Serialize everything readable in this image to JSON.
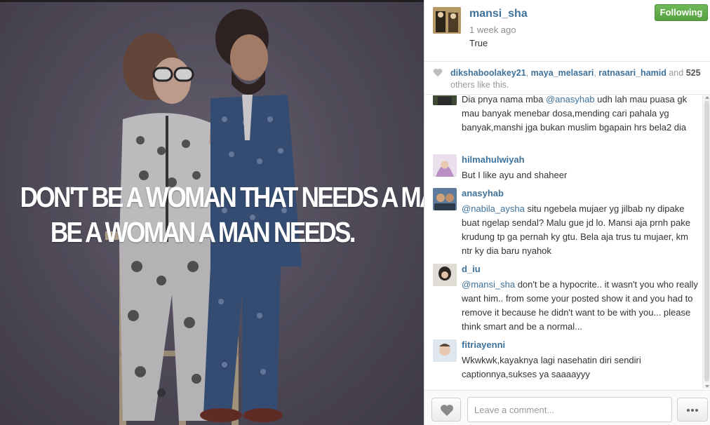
{
  "post": {
    "quote_line1": "DON'T BE A WOMAN THAT NEEDS A MAN,",
    "quote_line2": "BE A WOMAN A MAN NEEDS."
  },
  "header": {
    "username": "mansi_sha",
    "time_ago": "1 week ago",
    "caption": "True",
    "follow_label": "Following",
    "follow_color": "#5fae48"
  },
  "likes": {
    "user1": "dikshaboolakey21",
    "user2": "maya_melasari",
    "user3": "ratnasari_hamid",
    "and": "and",
    "count": "525",
    "suffix": "others like this.",
    "sep": ","
  },
  "comments": {
    "c0": {
      "text_a": "Dia pnya nama mba ",
      "mention": "@anasyhab",
      "text_b": " udh lah mau puasa gk mau banyak menebar dosa,mending cari pahala yg banyak,manshi jga bukan muslim bgapain hrs bela2 dia"
    },
    "c1": {
      "user": "hilmahulwiyah",
      "text": "But I like ayu and shaheer"
    },
    "c2": {
      "user": "anasyhab",
      "mention": "@nabila_aysha",
      "text": " situ ngebela mujaer yg jilbab ny dipake buat ngelap sendal? Malu gue jd lo. Mansi aja prnh pake krudung tp ga pernah ky gtu. Bela aja trus tu mujaer, km ntr ky dia baru nyahok"
    },
    "c3": {
      "user": "d_iu",
      "mention": "@mansi_sha",
      "text": " don't be a hypocrite.. it wasn't you who really want him.. from some your posted show it and you had to remove it because he didn't want to be with you... please think smart and be a normal..."
    },
    "c4": {
      "user": "fitriayenni",
      "text": "Wkwkwk,kayaknya lagi nasehatin diri sendiri captionnya,sukses ya saaaayyy"
    }
  },
  "footer": {
    "placeholder": "Leave a comment..."
  },
  "colors": {
    "link": "#3f729b",
    "muted": "#8e8e8e"
  }
}
